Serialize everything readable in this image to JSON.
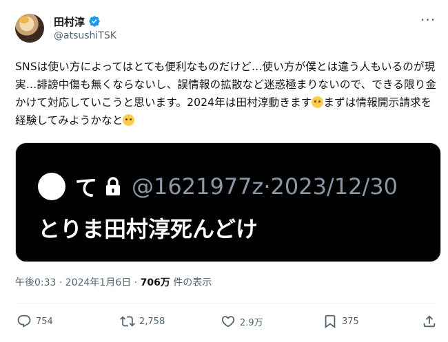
{
  "author": {
    "display_name": "田村淳",
    "handle": "@atsushiTSK"
  },
  "tweet": {
    "text_part1": "SNSは使い方によってはとても便利なものだけど…使い方が僕とは違う人もいるのが現実…誹謗中傷も無くならないし、誤情報の拡散など迷惑極まりないので、できる限り金かけて対応していこうと思います。2024年は田村淳動きます",
    "text_part2": "まずは情報開示請求を経験してみようかなと",
    "emoji1": "saluting-face-emoji",
    "emoji2": "thinking-face-emoji"
  },
  "media": {
    "name": "て",
    "handle_and_date": "@1621977z·2023/12/30",
    "body": "とりま田村淳死んどけ"
  },
  "meta": {
    "time": "午後0:33 · 2024年1月6日 · ",
    "views": "706万",
    "views_suffix": " 件の表示"
  },
  "actions": {
    "replies": "754",
    "retweets": "2,758",
    "likes": "2.9万",
    "bookmarks": "375"
  },
  "colors": {
    "verified": "#1d9bf0",
    "secondary_text": "#536471",
    "media_bg": "#000000"
  }
}
